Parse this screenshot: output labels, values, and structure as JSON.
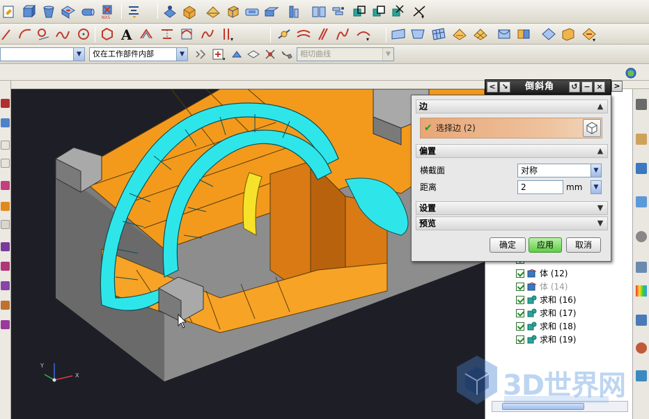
{
  "toolbar3": {
    "filter_value": "",
    "scope_value": "仅在工作部件内部",
    "curve_rule_value": "相切曲线"
  },
  "dialog": {
    "title": "倒斜角",
    "edge_section": {
      "header": "边",
      "select_label": "选择边 (2)"
    },
    "offset_section": {
      "header": "偏置",
      "cross_section_label": "横截面",
      "cross_section_value": "对称",
      "distance_label": "距离",
      "distance_value": "2",
      "distance_unit": "mm"
    },
    "settings_section": {
      "header": "设置"
    },
    "preview_section": {
      "header": "预览"
    },
    "buttons": {
      "ok": "确定",
      "apply": "应用",
      "cancel": "取消"
    }
  },
  "navigator": {
    "rows": [
      {
        "label": "体 (12)",
        "dim": false
      },
      {
        "label": "体 (14)",
        "dim": true
      },
      {
        "label": "求和 (16)",
        "dim": false
      },
      {
        "label": "求和 (17)",
        "dim": false
      },
      {
        "label": "求和 (18)",
        "dim": false
      },
      {
        "label": "求和 (19)",
        "dim": false
      }
    ]
  },
  "triad": {
    "x": "X",
    "y": "Y"
  },
  "watermark": {
    "text": "3D世界网"
  },
  "colors": {
    "viewport_bg": "#1e1f26",
    "part_orange": "#f39a1d",
    "part_gray": "#8f8f8f",
    "highlight_cyan": "#2ee6ea",
    "select_yellow": "#f6e22a"
  }
}
